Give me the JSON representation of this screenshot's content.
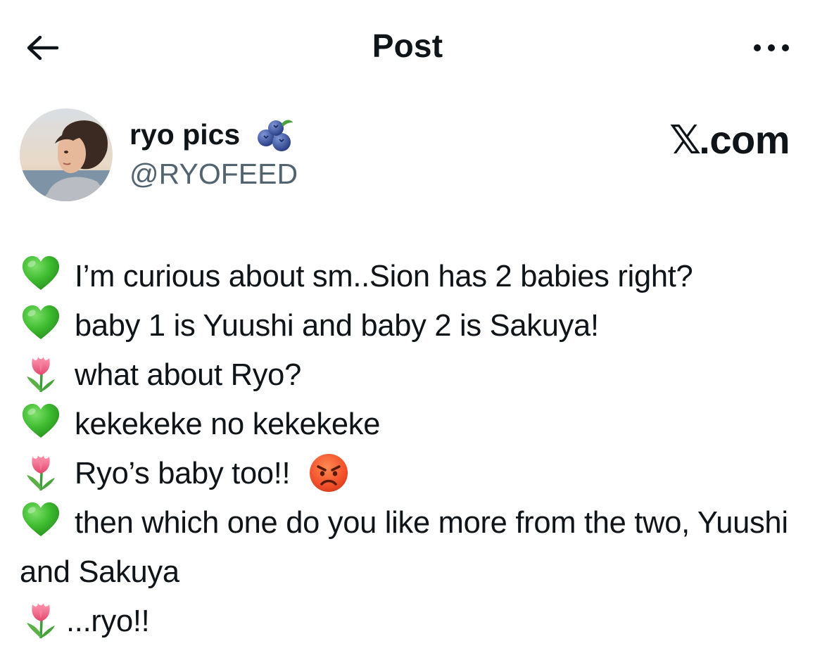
{
  "header": {
    "title": "Post"
  },
  "author": {
    "name": "ryo pics",
    "handle": "@RYOFEED",
    "badge_icon": "blueberry-icon"
  },
  "source": {
    "label_x": "𝕏",
    "label_rest": ".com"
  },
  "tweet": {
    "lines": [
      {
        "emoji": "green-heart-icon",
        "text": "I’m curious about sm..Sion has 2 babies right?"
      },
      {
        "emoji": "green-heart-icon",
        "text": "baby 1 is Yuushi and baby 2 is Sakuya!"
      },
      {
        "emoji": "tulip-icon",
        "text": "what about Ryo?"
      },
      {
        "emoji": "green-heart-icon",
        "text": "kekekeke no kekekeke"
      },
      {
        "emoji": "tulip-icon",
        "text": "Ryo’s baby too!!",
        "trailing_emoji": "angry-face-icon"
      },
      {
        "emoji": "green-heart-icon",
        "text": "then which one do you like more from the two, Yuushi and Sakuya"
      },
      {
        "emoji": "tulip-icon",
        "text": "...ryo!!"
      }
    ]
  },
  "colors": {
    "text": "#0f1419",
    "secondary_text": "#536471",
    "green_heart": "#3dbb2f",
    "tulip_pink": "#f06b8f",
    "angry_face": "#f24f2a"
  }
}
